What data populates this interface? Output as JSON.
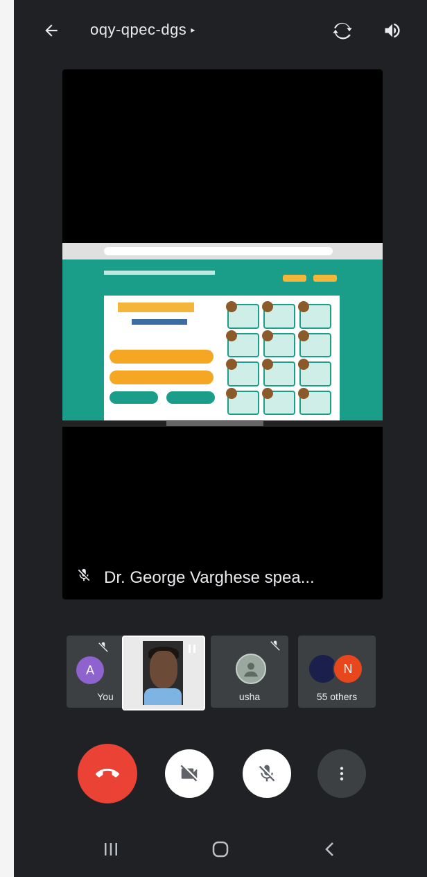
{
  "header": {
    "meeting_code": "oqy-qpec-dgs",
    "back_icon": "back-arrow-icon",
    "switch_camera_icon": "switch-camera-icon",
    "speaker_icon": "speaker-volume-icon"
  },
  "stage": {
    "speaker_label": "Dr. George Varghese spea...",
    "speaker_muted_icon": "mic-off-icon"
  },
  "participants": [
    {
      "name": "You",
      "avatar_letter": "A",
      "avatar_color": "#8e63ce",
      "muted": true
    },
    {
      "name": "",
      "type": "video",
      "paused": true
    },
    {
      "name": "usha",
      "avatar_type": "photo",
      "muted": true
    },
    {
      "name": "55 others",
      "avatar_letters": [
        "",
        "N"
      ],
      "avatar_colors": [
        "#1a1f4b",
        "#e8471e"
      ]
    }
  ],
  "controls": {
    "end_call_icon": "end-call-icon",
    "camera_off_icon": "camera-off-icon",
    "mic_off_icon": "mic-off-icon",
    "more_icon": "more-vert-icon",
    "end_call_color": "#ea4335"
  },
  "navbar": {
    "recents_icon": "recents-icon",
    "home_icon": "home-icon",
    "back_icon": "nav-back-icon"
  }
}
